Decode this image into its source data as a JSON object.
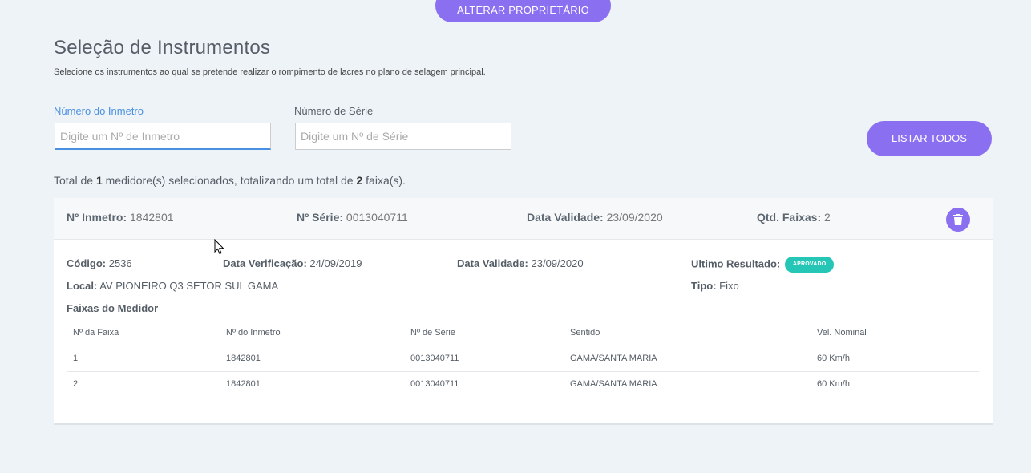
{
  "top_button": "ALTERAR PROPRIETÁRIO",
  "title": "Seleção de Instrumentos",
  "subtitle": "Selecione os instrumentos ao qual se pretende realizar o rompimento de lacres no plano de selagem principal.",
  "inmetro": {
    "label": "Número do Inmetro",
    "placeholder": "Digite um Nº de Inmetro"
  },
  "serie": {
    "label": "Número de Série",
    "placeholder": "Digite um Nº de Série"
  },
  "list_button": "LISTAR TODOS",
  "total": {
    "prefix": "Total de ",
    "medidores": "1",
    "middle": " medidore(s) selecionados, totalizando um total de ",
    "faixas": "2",
    "suffix": " faixa(s)."
  },
  "card": {
    "inmetro_label": "Nº Inmetro:",
    "inmetro_value": "1842801",
    "serie_label": "Nº Série:",
    "serie_value": "0013040711",
    "validade_label": "Data Validade:",
    "validade_value": "23/09/2020",
    "faixas_label": "Qtd. Faixas:",
    "faixas_value": "2",
    "codigo_label": "Código:",
    "codigo_value": "2536",
    "verificacao_label": "Data Verificação:",
    "verificacao_value": "24/09/2019",
    "validade2_label": "Data Validade:",
    "validade2_value": "23/09/2020",
    "resultado_label": "Ultimo Resultado:",
    "resultado_badge": "APROVADO",
    "local_label": "Local:",
    "local_value": "AV PIONEIRO Q3 SETOR SUL GAMA",
    "tipo_label": "Tipo:",
    "tipo_value": "Fixo",
    "faixas_title": "Faixas do Medidor"
  },
  "table": {
    "headers": [
      "Nº da Faixa",
      "Nº do Inmetro",
      "Nº de Série",
      "Sentido",
      "Vel. Nominal"
    ],
    "rows": [
      [
        "1",
        "1842801",
        "0013040711",
        "GAMA/SANTA MARIA",
        "60 Km/h"
      ],
      [
        "2",
        "1842801",
        "0013040711",
        "GAMA/SANTA MARIA",
        "60 Km/h"
      ]
    ]
  },
  "colors": {
    "accent": "#8a6ff0",
    "badge": "#26c6b6",
    "focus": "#4a90e2"
  }
}
